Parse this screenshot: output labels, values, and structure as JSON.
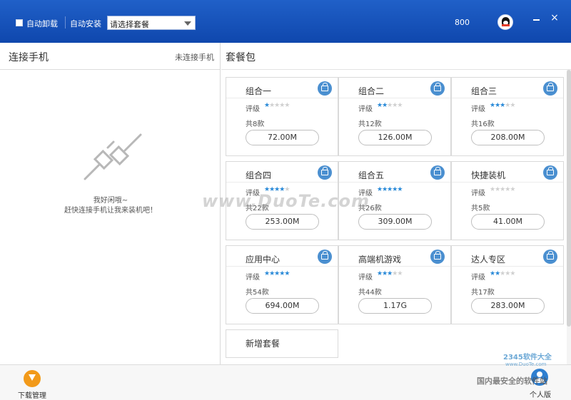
{
  "titlebar": {
    "auto_uninstall": "自动卸载",
    "auto_install": "自动安装",
    "package_select": "请选择套餐",
    "count": "800",
    "minimize": "",
    "close": "×"
  },
  "left": {
    "title": "连接手机",
    "status": "未连接手机",
    "empty_line1": "我好闲哦~",
    "empty_line2": "赶快连接手机让我来装机吧！"
  },
  "right": {
    "title": "套餐包",
    "rating_label": "评级",
    "packages": [
      {
        "name": "组合一",
        "stars": 1,
        "count": "共8款",
        "size": "72.00M"
      },
      {
        "name": "组合二",
        "stars": 2,
        "count": "共12款",
        "size": "126.00M"
      },
      {
        "name": "组合三",
        "stars": 3,
        "count": "共16款",
        "size": "208.00M"
      },
      {
        "name": "组合四",
        "stars": 4,
        "count": "共22款",
        "size": "253.00M"
      },
      {
        "name": "组合五",
        "stars": 5,
        "count": "共26款",
        "size": "309.00M"
      },
      {
        "name": "快捷装机",
        "stars": 0,
        "count": "共5款",
        "size": "41.00M"
      },
      {
        "name": "应用中心",
        "stars": 5,
        "count": "共54款",
        "size": "694.00M"
      },
      {
        "name": "高端机游戏",
        "stars": 3,
        "count": "共44款",
        "size": "1.17G"
      },
      {
        "name": "达人专区",
        "stars": 2,
        "count": "共17款",
        "size": "283.00M"
      }
    ],
    "new_package": "新增套餐"
  },
  "bottom": {
    "download_label": "下载管理",
    "personal_label": "个人版"
  },
  "watermarks": {
    "duote": "www.DuoTe.com",
    "site_2345": "2345软件大全",
    "site_2345_url": "www.DuoTe.com",
    "slogan": "国内最安全的软件站"
  },
  "colors": {
    "titlebar": "#1a55bd",
    "star_on": "#2a8ad8",
    "star_off": "#d0d0d0",
    "download_icon": "#f29a1a",
    "personal_icon": "#2f7fd0"
  }
}
